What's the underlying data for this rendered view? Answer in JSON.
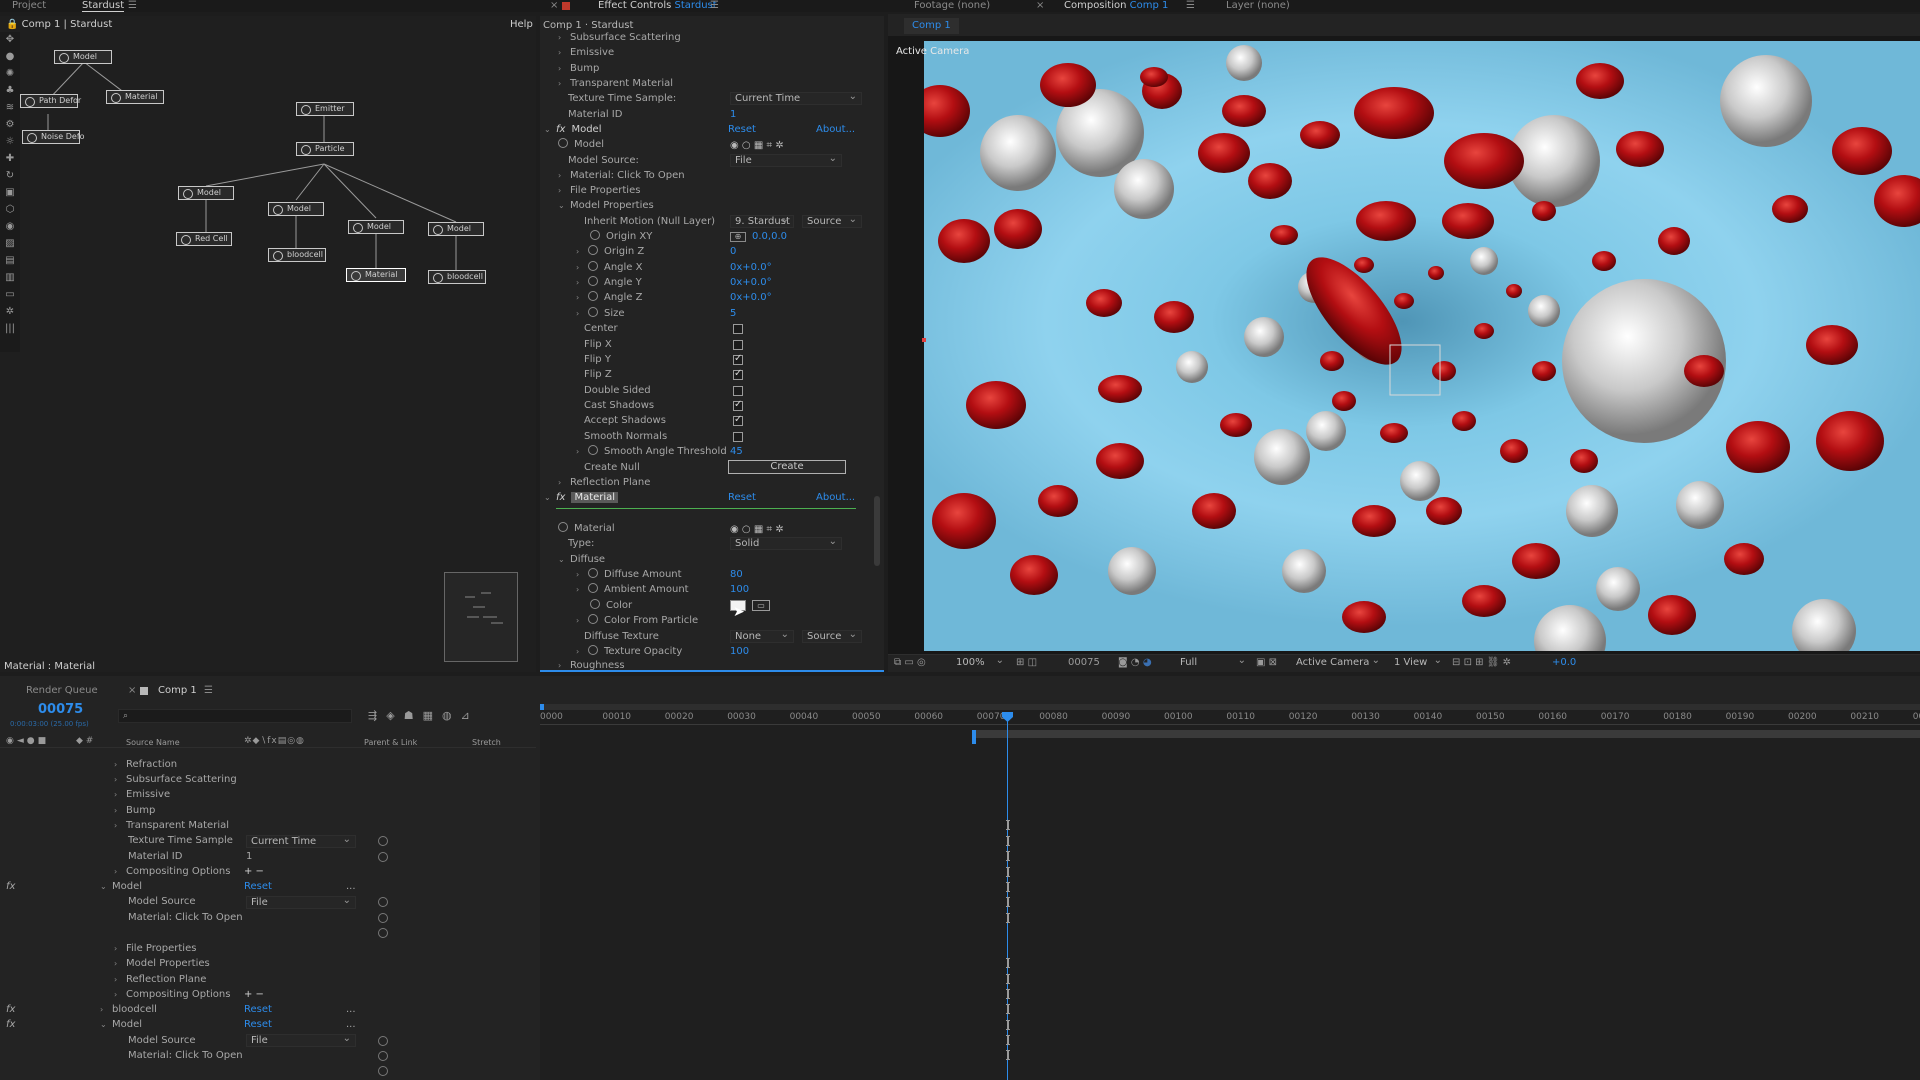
{
  "top_bar": {
    "project_tab": "Project",
    "stardust_tab": "Stardust",
    "effect_controls_tab": "Effect Controls",
    "effect_controls_layer": "Stardust",
    "footage_tab": "Footage",
    "footage_value": "(none)",
    "composition_tab": "Composition",
    "composition_value": "Comp 1",
    "layer_tab": "Layer",
    "layer_value": "(none)"
  },
  "stardust_panel": {
    "breadcrumb_comp": "Comp 1",
    "breadcrumb_layer": "Stardust",
    "help": "Help",
    "footer": "Material : Material",
    "nodes": {
      "model_top": "Model",
      "path_deform": "Path Defor",
      "material_top": "Material",
      "noise_deform": "Noise Defo",
      "emitter": "Emitter",
      "particle": "Particle",
      "model_1": "Model",
      "red_cell": "Red Cell",
      "model_2": "Model",
      "bloodcell_1": "bloodcell",
      "model_3": "Model",
      "material_sel": "Material",
      "model_4": "Model",
      "bloodcell_2": "bloodcell"
    }
  },
  "effect_controls": {
    "header": "Comp 1 · Stardust",
    "rows": {
      "subsurface": "Subsurface Scattering",
      "emissive": "Emissive",
      "bump": "Bump",
      "transparent": "Transparent Material",
      "texture_time_sample": "Texture Time Sample:",
      "texture_time_sample_value": "Current Time",
      "material_id": "Material ID",
      "material_id_value": "1",
      "fx_model": "Model",
      "reset": "Reset",
      "about": "About...",
      "model": "Model",
      "model_source": "Model Source:",
      "model_source_value": "File",
      "material_click": "Material: Click To Open",
      "file_properties": "File Properties",
      "model_properties": "Model Properties",
      "inherit_motion": "Inherit Motion (Null Layer)",
      "inherit_motion_value": "9. Stardust",
      "inherit_source": "Source",
      "origin_xy": "Origin XY",
      "origin_xy_value": "0.0,0.0",
      "origin_z": "Origin Z",
      "origin_z_value": "0",
      "angle_x": "Angle X",
      "angle_x_value": "0x+0.0°",
      "angle_y": "Angle Y",
      "angle_y_value": "0x+0.0°",
      "angle_z": "Angle Z",
      "angle_z_value": "0x+0.0°",
      "size": "Size",
      "size_value": "5",
      "center": "Center",
      "flip_x": "Flip X",
      "flip_y": "Flip Y",
      "flip_z": "Flip Z",
      "double_sided": "Double Sided",
      "cast_shadows": "Cast Shadows",
      "accept_shadows": "Accept Shadows",
      "smooth_normals": "Smooth Normals",
      "smooth_angle": "Smooth Angle Threshold",
      "smooth_angle_value": "45",
      "create_null": "Create Null",
      "create_button": "Create",
      "reflection_plane": "Reflection Plane",
      "fx_material": "Material",
      "material": "Material",
      "type": "Type:",
      "type_value": "Solid",
      "diffuse": "Diffuse",
      "diffuse_amount": "Diffuse Amount",
      "diffuse_amount_value": "80",
      "ambient_amount": "Ambient Amount",
      "ambient_amount_value": "100",
      "color": "Color",
      "color_from_particle": "Color From Particle",
      "diffuse_texture": "Diffuse Texture",
      "diffuse_texture_value": "None",
      "diffuse_texture_source": "Source",
      "texture_opacity": "Texture Opacity",
      "texture_opacity_value": "100",
      "roughness": "Roughness"
    }
  },
  "composition": {
    "tab": "Comp 1",
    "active_camera_label": "Active Camera",
    "zoom": "100%",
    "timecode": "00075",
    "resolution": "Full",
    "camera": "Active Camera",
    "views": "1 View",
    "exposure": "+0.0"
  },
  "timeline": {
    "render_queue_tab": "Render Queue",
    "comp_tab": "Comp 1",
    "timecode": "00075",
    "timecode_sub": "0:00:03:00 (25.00 fps)",
    "col_source_name": "Source Name",
    "col_parent": "Parent & Link",
    "col_stretch": "Stretch",
    "ruler": [
      "0000",
      "00010",
      "00020",
      "00030",
      "00040",
      "00050",
      "00060",
      "00070",
      "00080",
      "00090",
      "00100",
      "00110",
      "00120",
      "00130",
      "00140",
      "00150",
      "00160",
      "00170",
      "00180",
      "00190",
      "00200",
      "00210",
      "00220"
    ],
    "layers": {
      "refraction": "Refraction",
      "subsurface": "Subsurface Scattering",
      "emissive": "Emissive",
      "bump": "Bump",
      "transparent": "Transparent Material",
      "texture_time_sample": "Texture Time Sample",
      "texture_time_sample_value": "Current Time",
      "material_id": "Material ID",
      "material_id_value": "1",
      "compositing_options_1": "Compositing Options",
      "pm_1": "+ −",
      "model_1": "Model",
      "reset_1": "Reset",
      "model_source_1": "Model Source",
      "model_source_value_1": "File",
      "material_click_1": "Material: Click To Open",
      "file_properties": "File Properties",
      "model_properties": "Model Properties",
      "reflection_plane": "Reflection Plane",
      "compositing_options_2": "Compositing Options",
      "pm_2": "+ −",
      "bloodcell": "bloodcell",
      "reset_2": "Reset",
      "model_2": "Model",
      "reset_3": "Reset",
      "model_source_2": "Model Source",
      "model_source_value_2": "File",
      "material_click_2": "Material: Click To Open",
      "dots": "...",
      "fx": "fx"
    }
  },
  "colors": {
    "accent": "#2d8ceb",
    "panel_bg": "#232323",
    "blood_red": "#b80f12",
    "vessel_blue": "#7ec8e6"
  }
}
